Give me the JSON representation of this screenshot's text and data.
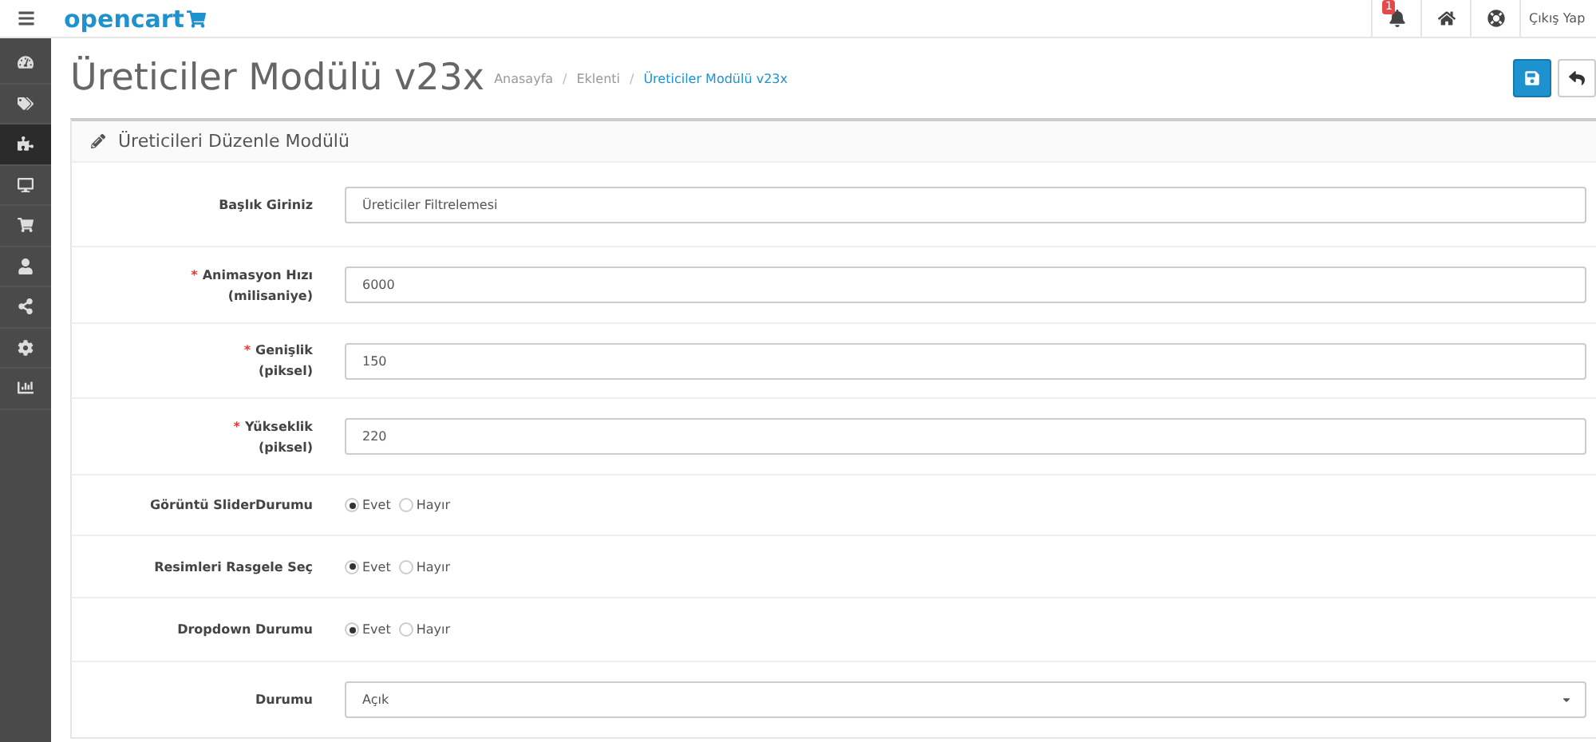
{
  "header": {
    "logo": "opencart",
    "notification_count": "1",
    "logout": "Çıkış Yap"
  },
  "sidebar": {
    "items": [
      {
        "selected": false
      },
      {
        "selected": false
      },
      {
        "selected": true
      },
      {
        "selected": false
      },
      {
        "selected": false
      },
      {
        "selected": false
      },
      {
        "selected": false
      },
      {
        "selected": false
      },
      {
        "selected": false
      }
    ]
  },
  "page": {
    "title": "Üreticiler Modülü v23x",
    "separator": "/",
    "breadcrumbs": [
      {
        "label": "Anasayfa",
        "current": false
      },
      {
        "label": "Eklenti",
        "current": false
      },
      {
        "label": "Üreticiler Modülü v23x",
        "current": true
      }
    ]
  },
  "panel": {
    "title": "Üreticileri Düzenle Modülü",
    "fields": [
      {
        "kind": "text",
        "label": "Başlık Giriniz",
        "value": "Üreticiler Filtrelemesi"
      },
      {
        "kind": "text",
        "label": "Animasyon Hızı",
        "sublabel": "(milisaniye)",
        "required_mark": "*",
        "value": "6000"
      },
      {
        "kind": "text",
        "label": "Genişlik",
        "sublabel": "(piksel)",
        "required_mark": "*",
        "value": "150"
      },
      {
        "kind": "text",
        "label": "Yükseklik",
        "sublabel": "(piksel)",
        "required_mark": "*",
        "value": "220"
      },
      {
        "kind": "radio",
        "label": "Görüntü SliderDurumu",
        "options": [
          {
            "label": "Evet",
            "selected": true
          },
          {
            "label": "Hayır",
            "selected": false
          }
        ]
      },
      {
        "kind": "radio",
        "label": "Resimleri Rasgele Seç",
        "options": [
          {
            "label": "Evet",
            "selected": true
          },
          {
            "label": "Hayır",
            "selected": false
          }
        ]
      },
      {
        "kind": "radio",
        "label": "Dropdown Durumu",
        "options": [
          {
            "label": "Evet",
            "selected": true
          },
          {
            "label": "Hayır",
            "selected": false
          }
        ]
      },
      {
        "kind": "select",
        "label": "Durumu",
        "value": "Açık"
      }
    ]
  }
}
